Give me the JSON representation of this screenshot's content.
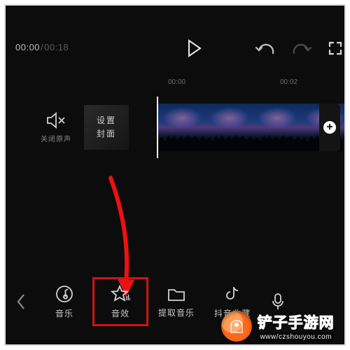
{
  "timecode": {
    "current": "00:00",
    "duration": "00:18"
  },
  "ruler": {
    "marks": [
      "00:00",
      "00:02"
    ]
  },
  "leftStrip": {
    "mute_label": "关闭原声",
    "cover_line1": "设置",
    "cover_line2": "封面"
  },
  "toolbar": {
    "items": [
      {
        "key": "music",
        "label": "音乐"
      },
      {
        "key": "sfx",
        "label": "音效"
      },
      {
        "key": "extract",
        "label": "提取音乐"
      },
      {
        "key": "douyin",
        "label": "抖音收藏"
      },
      {
        "key": "record",
        "label": "录音"
      }
    ],
    "selected": "sfx"
  },
  "watermark": {
    "name": "铲子手游网",
    "url": "www/czshouyou.com"
  },
  "icons": {
    "play": "play-icon",
    "undo": "undo-icon",
    "redo": "redo-icon",
    "expand": "expand-icon",
    "mute": "speaker-mute-icon",
    "back": "chevron-left-icon",
    "add": "plus-icon",
    "music": "music-note-icon",
    "sfx": "star-icon",
    "extract": "folder-icon",
    "douyin": "douyin-icon",
    "record": "microphone-icon"
  }
}
